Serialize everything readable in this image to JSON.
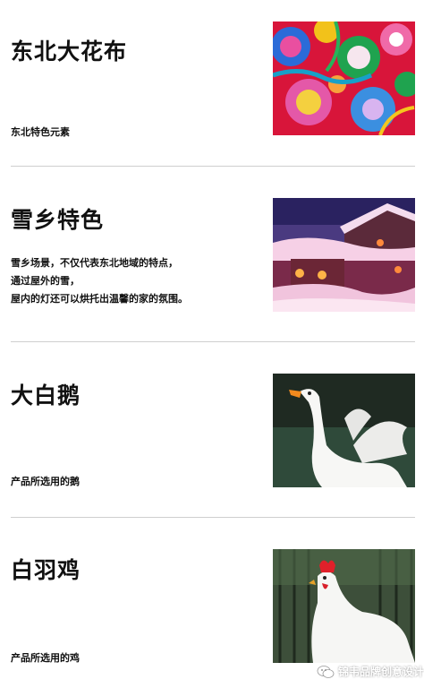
{
  "sections": [
    {
      "title": "东北大花布",
      "lines": [
        "东北特色元素"
      ]
    },
    {
      "title": "雪乡特色",
      "lines": [
        "雪乡场景，不仅代表东北地域的特点，",
        "通过屋外的雪，",
        "屋内的灯还可以烘托出温馨的家的氛围。"
      ]
    },
    {
      "title": "大白鹅",
      "lines": [
        "产品所选用的鹅"
      ]
    },
    {
      "title": "白羽鸡",
      "lines": [
        "产品所选用的鸡"
      ]
    }
  ],
  "watermark": {
    "text": "锦韦品牌创意设计",
    "icon": "wechat-icon"
  }
}
